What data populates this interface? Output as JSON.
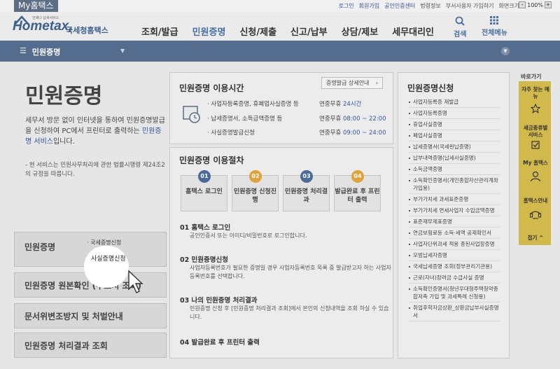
{
  "topbar": {
    "brand": "My홈택스",
    "util": [
      "로그인",
      "회원가입",
      "공인인증센터",
      "법령정보",
      "부서사용자 가입하기",
      "화면크기"
    ],
    "zoom": "100%",
    "zoom_minus": "-",
    "zoom_plus": "+"
  },
  "header": {
    "logo_tagline": "언제나 납세서비스",
    "logo_main": "Hometax,",
    "logo_sub": "국세청홈택스",
    "nav": [
      "조회/발급",
      "민원증명",
      "신청/제출",
      "신고/납부",
      "상담/제보",
      "세무대리인"
    ],
    "search": "검색",
    "all_menu": "전체메뉴"
  },
  "subbar": {
    "title": "민원증명"
  },
  "left": {
    "page_title": "민원증명",
    "desc_pre": "세무서 방문 없이 인터넷을 통하여 민원증명발급을 신청하여 PC에서 프린터로 출력하는 ",
    "desc_link": "민원증명 서비스",
    "desc_post": "입니다.",
    "note": "- 현 서비스는 민원사무처리에 관한 법률시행령 제24조2의 규정을 따릅니다.",
    "buttons": [
      "민원증명",
      "민원증명 원본확인 (수요처 조회)",
      "문서위변조방지 및 처벌안내",
      "민원증명 처리결과 조회"
    ],
    "popup_items": [
      "국세증명신청",
      "사실증명신청"
    ]
  },
  "hours": {
    "title": "민원증명 이용시간",
    "detail_button": "증명발급 상세안내",
    "rows": [
      {
        "label": "사업자등록증명, 휴폐업사실증명 등",
        "days": "연중무휴",
        "time": "24시간"
      },
      {
        "label": "납세증명서, 소득금액증명 등",
        "days": "연중무휴",
        "time": "08:00 ~ 22:00"
      },
      {
        "label": "사실증명발급신청",
        "days": "연중무휴",
        "time": "09:00 ~ 24:00"
      }
    ]
  },
  "procedure": {
    "title": "민원증명 이용절차",
    "steps": [
      {
        "num": "01",
        "label": "홈택스 로그인"
      },
      {
        "num": "02",
        "label": "민원증명 신청진행"
      },
      {
        "num": "03",
        "label": "민원증명 처리결과"
      },
      {
        "num": "04",
        "label": "발급완료 후 프린터 출력"
      }
    ],
    "details": [
      {
        "head": "01 홈택스 로그인",
        "body": "공인인증서 또는 아이디/비밀번호로 로그인합니다."
      },
      {
        "head": "02 민원증명신청",
        "body": "사업자등록번호가 필요한 증명일 경우 사업자등록번호 목록 중 발급받고자 하는 사업자등록번호를 선택합니다."
      },
      {
        "head": "03 나의 민원증명 처리결과",
        "body": "민원증명 신청 후 [민원증명 처리결과 조회]에서 본인의 신청내역을 조회 하실 수 있습니다."
      },
      {
        "head": "04 발급완료 후 프린터 출력",
        "body": ""
      }
    ]
  },
  "right": {
    "title": "민원증명신청",
    "items": [
      "사업자등록증 재발급",
      "사업자등록증명",
      "휴업사실증명",
      "폐업사실증명",
      "납세증명서(국세완납증명)",
      "납부내역증명(납세사실증명)",
      "소득금액증명",
      "소득확인증명서(개인종합자산관리계좌 가입용)",
      "부가가치세 과세표준증명",
      "부가가치세 면세사업자 수입금액증명",
      "표준재무제표증명",
      "연금보험료등 소득·세액 공제확인서",
      "사업자단위과세 적용 종된사업장증명",
      "모범납세자증명",
      "국세납세증명 조회(정부관리기관용)",
      "근로(자녀)장려금 수급사실 증명",
      "소득확인증명서(청년우대형주택청약종합저축 가입 및 과세특례 신청용)",
      "취업후학자금상환_상환금납부사실증명서"
    ]
  },
  "quick": {
    "title": "바로가기",
    "items": [
      "자주 찾는 메뉴",
      "세금종류별 서비스",
      "My 홈택스",
      "홈택스안내"
    ],
    "fold": "접기"
  }
}
